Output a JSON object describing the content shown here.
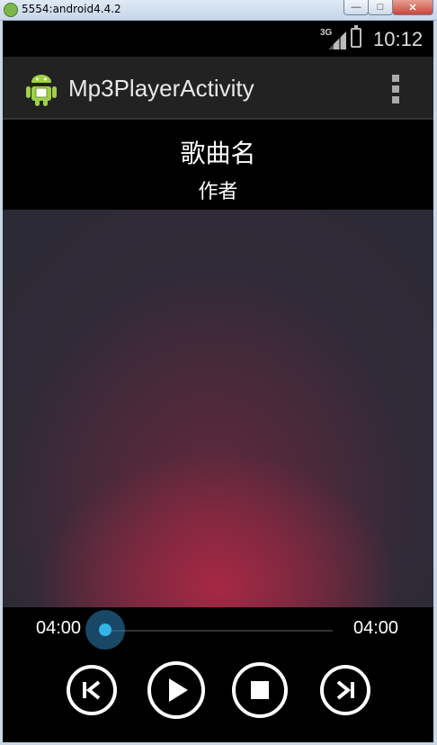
{
  "window": {
    "title": "5554:android4.4.2",
    "minimize_icon": "minimize-icon",
    "maximize_icon": "maximize-icon",
    "close_icon": "close-icon"
  },
  "status_bar": {
    "network": "3G",
    "time": "10:12"
  },
  "action_bar": {
    "title": "Mp3PlayerActivity",
    "icon": "android-robot-icon",
    "menu_icon": "overflow-menu-icon"
  },
  "song": {
    "name": "歌曲名",
    "artist": "作者"
  },
  "player": {
    "current_time": "04:00",
    "total_time": "04:00",
    "progress": 0.0,
    "accent_color": "#33b5e5",
    "buttons": {
      "previous": "skip-previous-icon",
      "play": "play-icon",
      "stop": "stop-icon",
      "next": "skip-next-icon"
    }
  }
}
